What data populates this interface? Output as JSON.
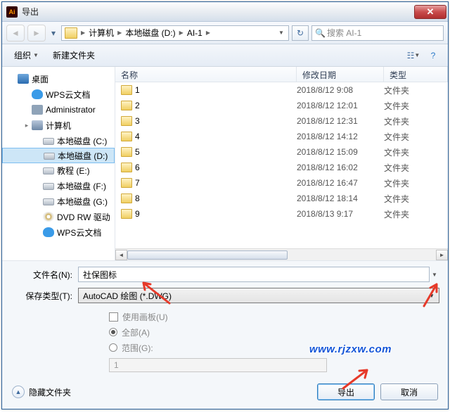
{
  "window": {
    "title": "导出"
  },
  "nav": {
    "path_segments": [
      "计算机",
      "本地磁盘 (D:)",
      "AI-1"
    ],
    "search_placeholder": "搜索 AI-1"
  },
  "toolbar": {
    "organize": "组织",
    "new_folder": "新建文件夹"
  },
  "tree": {
    "root": "桌面",
    "items": [
      {
        "label": "WPS云文档",
        "icon": "icn-cloud",
        "indent": 1
      },
      {
        "label": "Administrator",
        "icon": "icn-user",
        "indent": 1
      },
      {
        "label": "计算机",
        "icon": "icn-computer",
        "indent": 1,
        "expandable": true
      },
      {
        "label": "本地磁盘 (C:)",
        "icon": "icn-drive",
        "indent": 2
      },
      {
        "label": "本地磁盘 (D:)",
        "icon": "icn-drive",
        "indent": 2,
        "selected": true
      },
      {
        "label": "教程 (E:)",
        "icon": "icn-drive",
        "indent": 2
      },
      {
        "label": "本地磁盘 (F:)",
        "icon": "icn-drive",
        "indent": 2
      },
      {
        "label": "本地磁盘 (G:)",
        "icon": "icn-drive",
        "indent": 2
      },
      {
        "label": "DVD RW 驱动",
        "icon": "icn-dvd",
        "indent": 2
      },
      {
        "label": "WPS云文档",
        "icon": "icn-cloud",
        "indent": 2
      }
    ]
  },
  "columns": {
    "name": "名称",
    "date": "修改日期",
    "type": "类型"
  },
  "files": [
    {
      "name": "1",
      "date": "2018/8/12 9:08",
      "type": "文件夹"
    },
    {
      "name": "2",
      "date": "2018/8/12 12:01",
      "type": "文件夹"
    },
    {
      "name": "3",
      "date": "2018/8/12 12:31",
      "type": "文件夹"
    },
    {
      "name": "4",
      "date": "2018/8/12 14:12",
      "type": "文件夹"
    },
    {
      "name": "5",
      "date": "2018/8/12 15:09",
      "type": "文件夹"
    },
    {
      "name": "6",
      "date": "2018/8/12 16:02",
      "type": "文件夹"
    },
    {
      "name": "7",
      "date": "2018/8/12 16:47",
      "type": "文件夹"
    },
    {
      "name": "8",
      "date": "2018/8/12 18:14",
      "type": "文件夹"
    },
    {
      "name": "9",
      "date": "2018/8/13 9:17",
      "type": "文件夹"
    }
  ],
  "form": {
    "filename_label": "文件名(N):",
    "filename_value": "社保图标",
    "filetype_label": "保存类型(T):",
    "filetype_value": "AutoCAD 绘图 (*.DWG)",
    "use_artboard": "使用画板(U)",
    "all": "全部(A)",
    "range": "范围(G):",
    "range_value": "1"
  },
  "footer": {
    "hide_folders": "隐藏文件夹",
    "export": "导出",
    "cancel": "取消"
  },
  "watermark": "www.rjzxw.com"
}
